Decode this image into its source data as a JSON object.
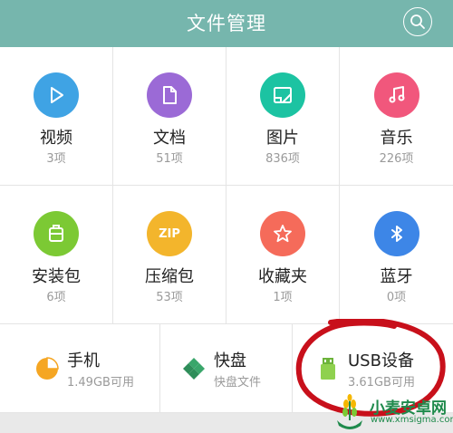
{
  "header": {
    "title": "文件管理",
    "icon": "search-icon",
    "color": "#76b6ad"
  },
  "categories": [
    {
      "label": "视频",
      "count": "3项",
      "icon": "play-icon",
      "color": "#3fa3e4"
    },
    {
      "label": "文档",
      "count": "51项",
      "icon": "document-icon",
      "color": "#9b6ad6"
    },
    {
      "label": "图片",
      "count": "836项",
      "icon": "image-icon",
      "color": "#1cc3a2"
    },
    {
      "label": "音乐",
      "count": "226项",
      "icon": "music-icon",
      "color": "#f1577c"
    },
    {
      "label": "安装包",
      "count": "6项",
      "icon": "package-icon",
      "color": "#7cc934"
    },
    {
      "label": "压缩包",
      "count": "53项",
      "icon": "zip-icon",
      "color": "#f3b52c",
      "icon_text": "ZIP"
    },
    {
      "label": "收藏夹",
      "count": "1项",
      "icon": "star-icon",
      "color": "#f56b5a"
    },
    {
      "label": "蓝牙",
      "count": "0项",
      "icon": "bluetooth-icon",
      "color": "#3d86e7"
    }
  ],
  "storage": [
    {
      "name": "手机",
      "sub": "1.49GB可用",
      "icon": "pie-chart-icon",
      "color": "#f5a623"
    },
    {
      "name": "快盘",
      "sub": "快盘文件",
      "icon": "kuaipan-icon",
      "color": "#3aa66b"
    },
    {
      "name": "USB设备",
      "sub": "3.61GB可用",
      "icon": "usb-drive-icon",
      "color": "#8fd14f"
    }
  ],
  "annotation": {
    "color": "#c8101b"
  },
  "watermark": {
    "text": "小麦安卓网",
    "url": "www.xmsigma.com",
    "icon": "wheat-logo-icon"
  }
}
